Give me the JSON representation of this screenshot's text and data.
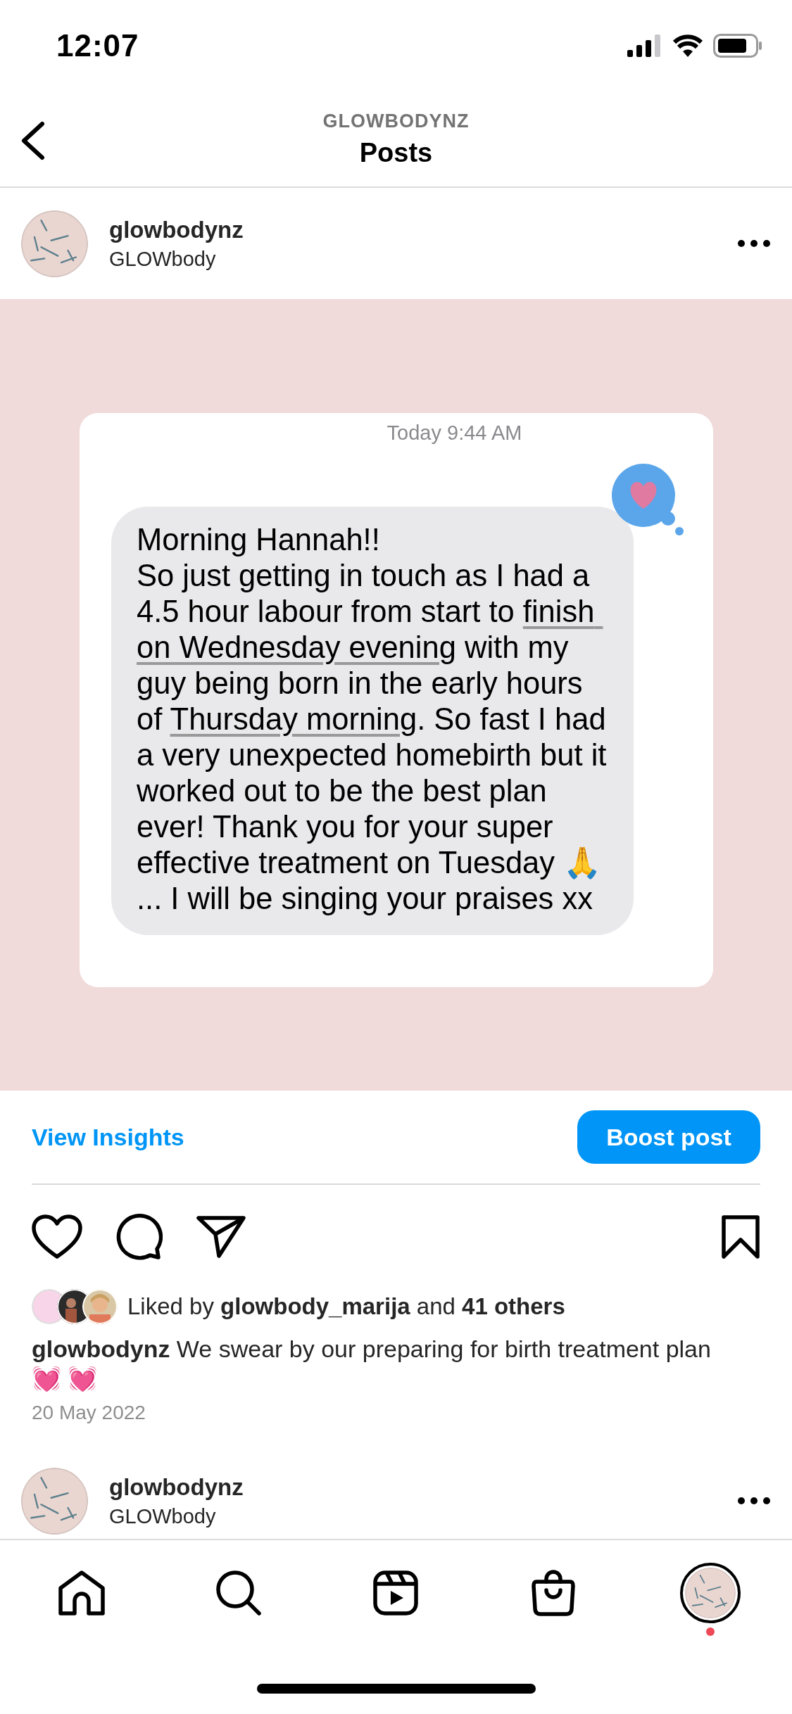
{
  "status_bar": {
    "time": "12:07"
  },
  "header": {
    "account": "GLOWBODYNZ",
    "title": "Posts"
  },
  "post": {
    "username": "glowbodynz",
    "subtitle": "GLOWbody",
    "image": {
      "kind": "message_screenshot",
      "timestamp": "Today 9:44 AM",
      "message": [
        {
          "text": "Morning Hannah!!\nSo just getting in touch as I had a 4.5 hour labour from start to ",
          "underlined": false
        },
        {
          "text": "finish on Wednesday evening",
          "underlined": true
        },
        {
          "text": " with my guy being born in the early hours of ",
          "underlined": false
        },
        {
          "text": "Thursday morning",
          "underlined": true
        },
        {
          "text": ". So fast I had a very unexpected homebirth but it worked out to be the best plan ever! Thank you for your super effective treatment on Tuesday 🙏 ... I will be singing your praises xx",
          "underlined": false
        }
      ]
    },
    "insights_link": "View Insights",
    "boost_button": "Boost post",
    "liked": false,
    "saved": false,
    "likes": "Liked by **glowbody_marija** and **41 others**",
    "caption": "**glowbodynz** We swear by our preparing for birth treatment plan 💓 💓",
    "date": "20 May 2022"
  },
  "next_post": {
    "username": "glowbodynz",
    "subtitle": "GLOWbody"
  },
  "tab_bar": [
    {
      "kind": "home",
      "selected": false
    },
    {
      "kind": "search",
      "selected": false
    },
    {
      "kind": "reels",
      "selected": false
    },
    {
      "kind": "shop",
      "selected": false
    },
    {
      "kind": "profile",
      "selected": true,
      "notification": true
    }
  ]
}
